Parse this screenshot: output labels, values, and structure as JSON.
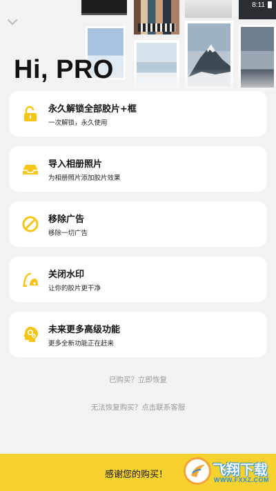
{
  "status_bar": {
    "time": "8:11"
  },
  "header": {
    "greeting": "Hi, PRO",
    "collapse_icon": "chevron-down-icon"
  },
  "colors": {
    "accent": "#f7d22e",
    "icon": "#f5c518",
    "card_bg": "#ffffff",
    "page_bg": "#f2f2f2",
    "muted_text": "#9a9a9a"
  },
  "features": [
    {
      "icon": "unlock-icon",
      "title": "永久解锁全部胶片+框",
      "subtitle": "一次解锁，永久使用"
    },
    {
      "icon": "inbox-tray-icon",
      "title": "导入相册照片",
      "subtitle": "为相册照片添加胶片效果"
    },
    {
      "icon": "no-ads-icon",
      "title": "移除广告",
      "subtitle": "移除一切广告"
    },
    {
      "icon": "vacuum-cleaner-icon",
      "title": "关闭水印",
      "subtitle": "让你的胶片更干净"
    },
    {
      "icon": "brain-gears-icon",
      "title": "未来更多高级功能",
      "subtitle": "更多全新功能正在赶来"
    }
  ],
  "links": {
    "restore": "已购买？立即恢复",
    "contact": "无法恢复购买？点击联系客服"
  },
  "footer": {
    "thanks": "感谢您的购买！",
    "watermark_text": "飞翔下载",
    "watermark_url": "WWW.FXXZ.COM"
  }
}
